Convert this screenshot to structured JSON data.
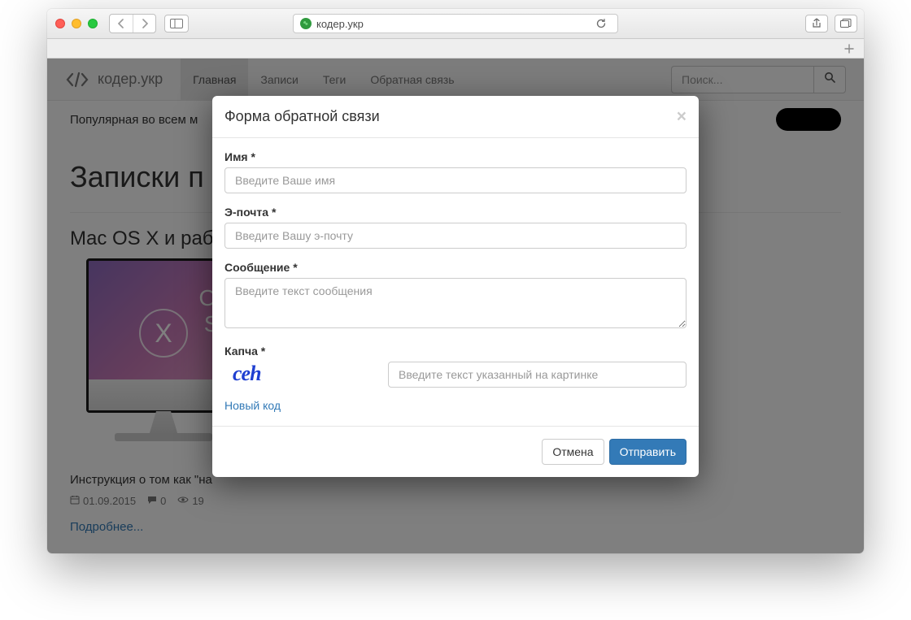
{
  "browser": {
    "url": "кодер.укр"
  },
  "site": {
    "brand": "кодер.укр",
    "nav": [
      "Главная",
      "Записи",
      "Теги",
      "Обратная связь"
    ],
    "search_placeholder": "Поиск..."
  },
  "banner": {
    "line": "Популярная во всем м"
  },
  "page": {
    "title": "Записки п"
  },
  "article": {
    "title": "Mac OS X и работа ",
    "screen_top": "OS",
    "screen_bottom": "Su",
    "circle_letter": "X",
    "desc": "Инструкция о том как \"на",
    "date": "01.09.2015",
    "comments": "0",
    "views": "19",
    "readmore": "Подробнее..."
  },
  "modal": {
    "title": "Форма обратной связи",
    "name_label": "Имя *",
    "name_placeholder": "Введите Ваше имя",
    "email_label": "Э-почта *",
    "email_placeholder": "Введите Вашу э-почту",
    "message_label": "Сообщение *",
    "message_placeholder": "Введите текст сообщения",
    "captcha_label": "Капча *",
    "captcha_text": "ceh",
    "captcha_new": "Новый код",
    "captcha_placeholder": "Введите текст указанный на картинке",
    "cancel": "Отмена",
    "submit": "Отправить"
  }
}
